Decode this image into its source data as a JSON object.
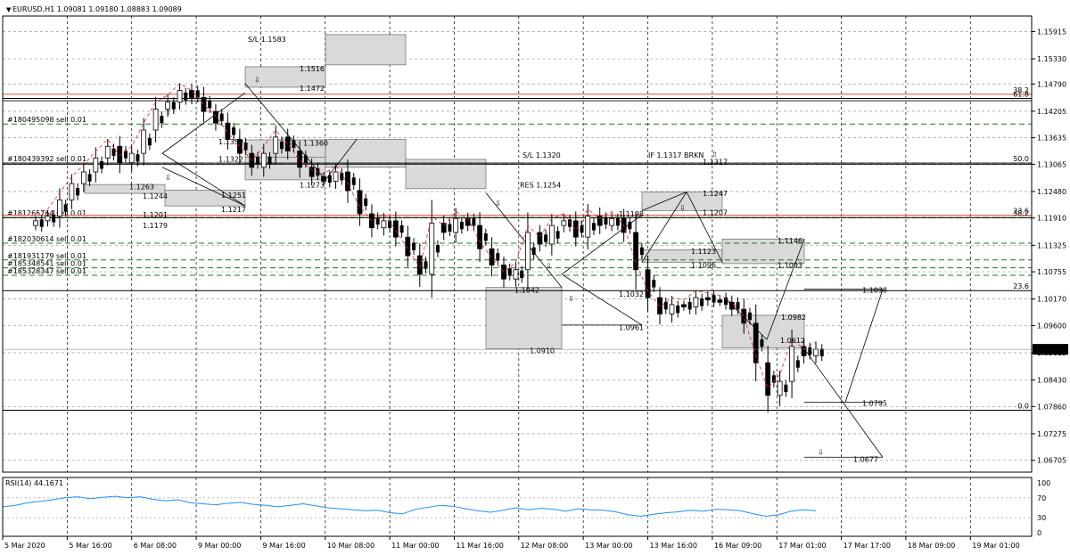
{
  "chart_data": {
    "type": "candlestick",
    "header": "EURUSD,H1  1.09081 1.09180 1.08883 1.09089",
    "current_price": 1.09089,
    "current_price_label": "1.09089",
    "ylim": [
      1.0645,
      1.1625
    ],
    "y_ticks": [
      "1.15915",
      "1.15330",
      "1.14790",
      "1.14205",
      "1.13635",
      "1.13065",
      "1.12480",
      "1.11910",
      "1.11325",
      "1.10755",
      "1.10170",
      "1.09600",
      "1.09015",
      "1.08430",
      "1.07860",
      "1.07275",
      "1.06705"
    ],
    "x_ticks": [
      "5 Mar 2020",
      "5 Mar 16:00",
      "6 Mar 08:00",
      "9 Mar 00:00",
      "9 Mar 16:00",
      "10 Mar 08:00",
      "11 Mar 00:00",
      "11 Mar 16:00",
      "12 Mar 08:00",
      "13 Mar 00:00",
      "13 Mar 16:00",
      "16 Mar 09:00",
      "17 Mar 01:00",
      "17 Mar 17:00",
      "18 Mar 09:00",
      "19 Mar 01:00"
    ],
    "close_path": [
      1.1185,
      1.1195,
      1.123,
      1.1265,
      1.129,
      1.132,
      1.1345,
      1.131,
      1.133,
      1.138,
      1.1425,
      1.144,
      1.1465,
      1.145,
      1.142,
      1.1395,
      1.136,
      1.133,
      1.13,
      1.133,
      1.1365,
      1.1335,
      1.13,
      1.128,
      1.127,
      1.129,
      1.125,
      1.12,
      1.117,
      1.1185,
      1.115,
      1.111,
      1.107,
      1.118,
      1.116,
      1.119,
      1.1175,
      1.1125,
      1.109,
      1.106,
      1.108,
      1.116,
      1.1135,
      1.1175,
      1.1185,
      1.115,
      1.1195,
      1.1175,
      1.119,
      1.116,
      1.108,
      1.102,
      1.0985,
      1.1005,
      1.1,
      1.102,
      1.1015,
      1.101,
      1.0995,
      1.0965,
      1.088,
      1.081,
      1.084,
      1.0915,
      1.0895,
      1.0909
    ],
    "rsi": {
      "label": "RSI(14) 44.1671",
      "ticks": [
        "100",
        "70",
        "30",
        "0"
      ],
      "values": [
        52,
        55,
        60,
        63,
        66,
        70,
        72,
        68,
        71,
        73,
        70,
        72,
        67,
        64,
        66,
        60,
        58,
        56,
        59,
        61,
        57,
        55,
        52,
        55,
        58,
        54,
        50,
        48,
        46,
        44,
        45,
        40,
        38,
        47,
        51,
        55,
        53,
        48,
        44,
        41,
        45,
        50,
        46,
        49,
        47,
        43,
        48,
        46,
        45,
        42,
        36,
        33,
        37,
        40,
        42,
        45,
        43,
        47,
        46,
        44,
        38,
        33,
        36,
        43,
        46,
        44
      ]
    },
    "pending_orders": [
      {
        "label": "#180495098 sell 0.01",
        "price": 1.1393
      },
      {
        "label": "#180439392 sell 0.01",
        "price": 1.1309
      },
      {
        "label": "#181265764 sell 0.01",
        "price": 1.1192
      },
      {
        "label": "#182030614 sell 0.01",
        "price": 1.1137
      },
      {
        "label": "#181931179 sell 0.01",
        "price": 1.1101
      },
      {
        "label": "#185348541 sell 0.01",
        "price": 1.1084
      },
      {
        "label": "#185328347 sell 0.01",
        "price": 1.1068
      }
    ],
    "fib_levels": [
      {
        "label": "38.2",
        "price": 1.1457,
        "color": "#e74c3c"
      },
      {
        "label": "61.8",
        "price": 1.1448,
        "color": "#000000"
      },
      {
        "label": "50.0",
        "price": 1.1309,
        "color": "#000000"
      },
      {
        "label": "23.6",
        "price": 1.1197,
        "color": "#e74c3c"
      },
      {
        "label": "38.2",
        "price": 1.1192,
        "color": "#000000"
      },
      {
        "label": "23.6",
        "price": 1.1035,
        "color": "#000000"
      },
      {
        "label": "0.0",
        "price": 1.0778,
        "color": "#000000"
      }
    ],
    "annotations": [
      "S/L 1.1583",
      "1.1516",
      "1.1472",
      "1.1359",
      "1.1322",
      "1.1360",
      "1.1273",
      "1.1251",
      "1.1263",
      "1.1244",
      "1.1201",
      "1.1179",
      "1.1217",
      "S/L 1.1320",
      "RES 1.1254",
      "1.1198",
      "IF 1.1317 BRKN",
      "1.1317",
      "1.1247",
      "1.1207",
      "1.1123",
      "1.1096",
      "1.1146",
      "1.1093",
      "1.1042",
      "1.0910",
      "1.1032",
      "1.0961",
      "1.1038",
      "1.0982",
      "1.0612",
      "1.0795",
      "1.0677"
    ],
    "colors": {
      "bull": "#000000",
      "bear": "#000000",
      "order_line": "#1a7f1a",
      "fib_red": "#e74c3c",
      "zone_fill": "#d9d9d9",
      "ma": "#d62728",
      "rsi": "#1e90ff"
    }
  }
}
